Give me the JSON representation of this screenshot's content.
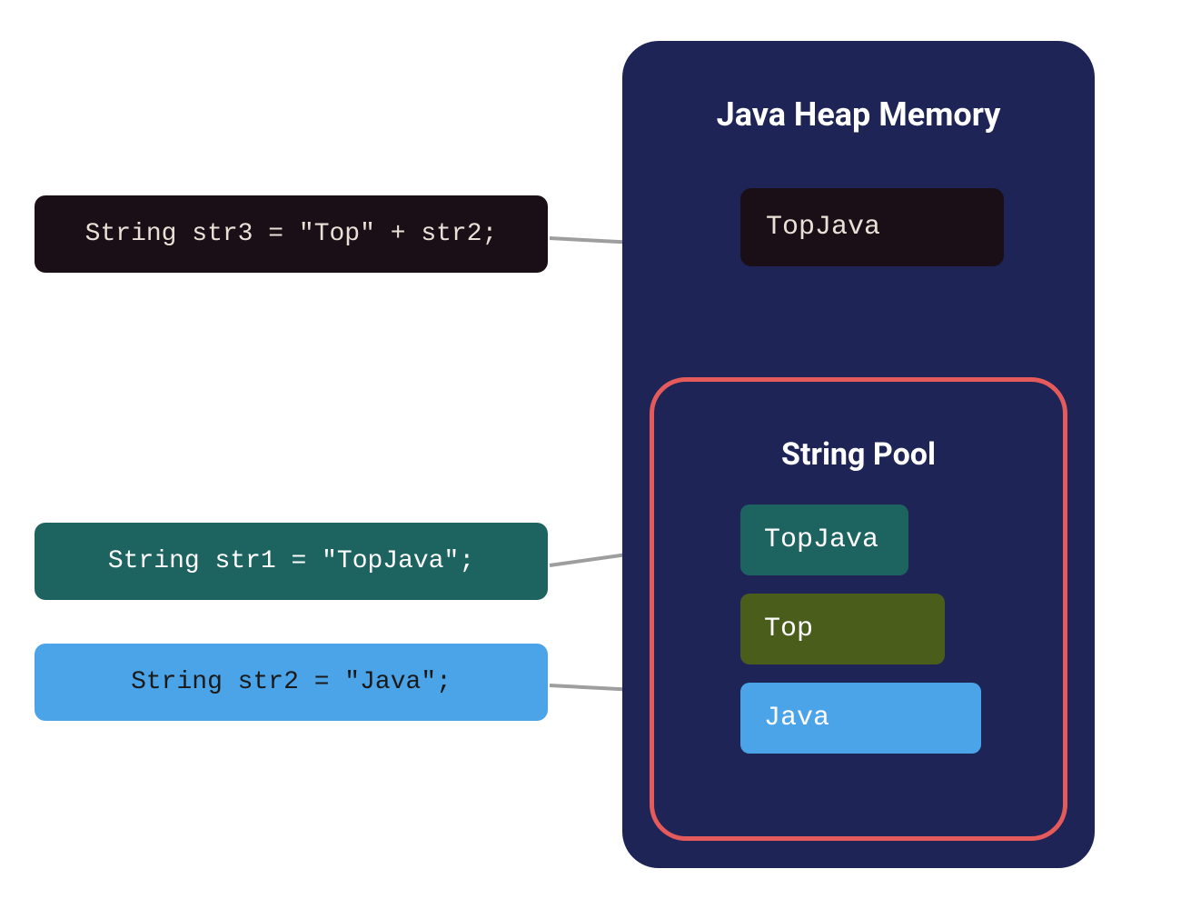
{
  "heap": {
    "title": "Java Heap Memory",
    "object": "TopJava"
  },
  "pool": {
    "title": "String Pool",
    "items": [
      {
        "label": "TopJava",
        "class": "teal"
      },
      {
        "label": "Top",
        "class": "olive"
      },
      {
        "label": "Java",
        "class": "blue"
      }
    ]
  },
  "code": {
    "str3": "String str3 = \"Top\" + str2;",
    "str1": "String str1 = \"TopJava\";",
    "str2": "String str2 = \"Java\";"
  }
}
